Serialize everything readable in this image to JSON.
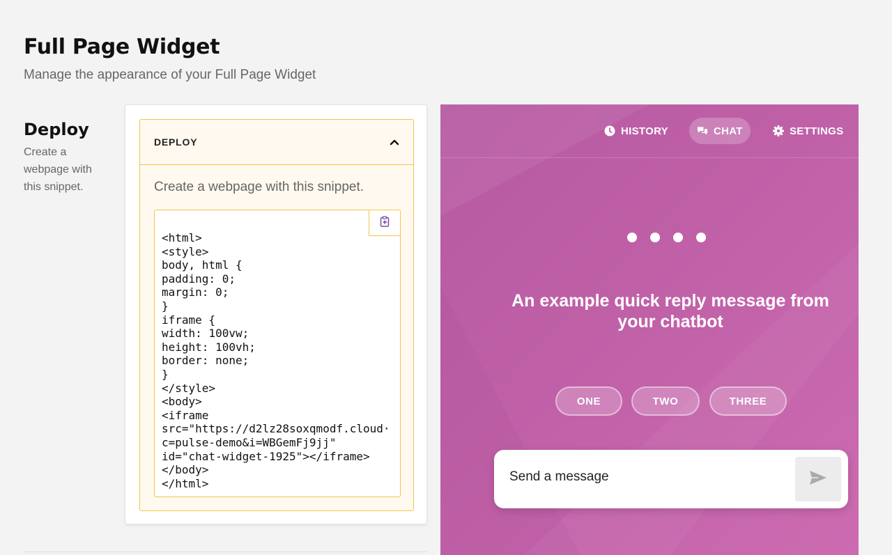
{
  "header": {
    "title": "Full Page Widget",
    "subtitle": "Manage the appearance of your Full Page Widget"
  },
  "section": {
    "title": "Deploy",
    "description": "Create a webpage with this snippet."
  },
  "accordion": {
    "title": "DEPLOY",
    "description": "Create a webpage with this snippet.",
    "code": "<html>\n<style>\nbody, html {\npadding: 0;\nmargin: 0;\n}\niframe {\nwidth: 100vw;\nheight: 100vh;\nborder: none;\n}\n</style>\n<body>\n<iframe\nsrc=\"https://d2lz28soxqmodf.cloud·\nc=pulse-demo&i=WBGemFj9jj\"\nid=\"chat-widget-1925\"></iframe>\n</body>\n</html>"
  },
  "preview": {
    "nav": [
      {
        "label": "HISTORY",
        "icon": "clock-icon"
      },
      {
        "label": "CHAT",
        "icon": "chat-bubbles-icon"
      },
      {
        "label": "SETTINGS",
        "icon": "gear-icon"
      }
    ],
    "bot_message": "An example quick reply message from your chatbot",
    "quick_replies": [
      "ONE",
      "TWO",
      "THREE"
    ],
    "composer_placeholder": "Send a message",
    "colors": {
      "widget_background": "#c161a8",
      "accent_border": "#f4c44a",
      "accordion_background": "#fff9ef"
    }
  }
}
